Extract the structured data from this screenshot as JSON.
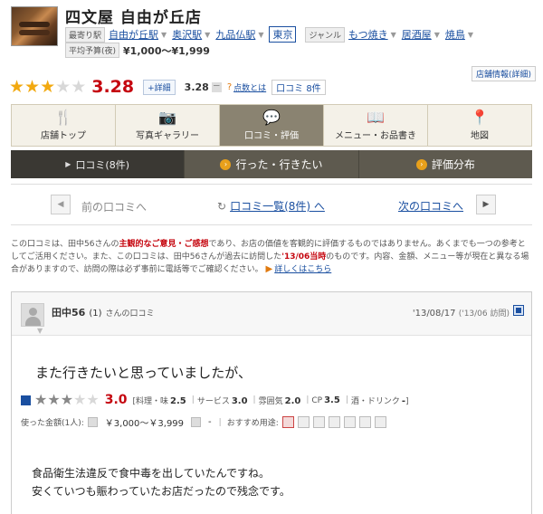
{
  "header": {
    "shop_name": "四文屋 自由が丘店",
    "nearest_label": "最寄り駅",
    "stations": [
      "自由が丘駅",
      "奥沢駅",
      "九品仏駅"
    ],
    "area": "東京",
    "genre_label": "ジャンル",
    "genres": [
      "もつ焼き",
      "居酒屋",
      "焼鳥"
    ],
    "budget_label": "平均予算(夜)",
    "budget": "¥1,000～¥1,999",
    "store_info": "店舗情報(詳細)"
  },
  "rating": {
    "stars": 3,
    "score": "3.28",
    "detail_button": "+詳細",
    "sub_score": "3.28",
    "sub_minus": "－",
    "score_info_link": "点数とは",
    "review_link": "口コミ 8件"
  },
  "tabs": [
    {
      "label": "店舗トップ",
      "icon": "fork-knife-icon",
      "glyph": "🍴"
    },
    {
      "label": "写真ギャラリー",
      "icon": "camera-icon",
      "glyph": "📷"
    },
    {
      "label": "口コミ・評価",
      "icon": "speech-bubble-icon",
      "glyph": "💬"
    },
    {
      "label": "メニュー・お品書き",
      "icon": "book-icon",
      "glyph": "📖"
    },
    {
      "label": "地図",
      "icon": "map-pin-icon",
      "glyph": "📍"
    }
  ],
  "subtabs": [
    {
      "label": "口コミ(8件)"
    },
    {
      "label": "行った・行きたい"
    },
    {
      "label": "評価分布"
    }
  ],
  "pager": {
    "prev": "前の口コミへ",
    "list": "口コミ一覧(8件) へ",
    "next": "次の口コミへ",
    "prev_arrow": "◀",
    "next_arrow": "▶",
    "list_icon": "↻"
  },
  "notice": {
    "p1a": "この口コミは、田中56さんの",
    "p1b": "主観的なご意見・ご感想",
    "p1c": "であり、お店の価値を客観的に評価するものではありません。あくまでも一つの参考としてご活用ください。また、この口コミは、田中56さんが過去に訪問した",
    "p1d": "'13/06当時",
    "p1e": "のものです。内容、金額、メニュー等が現在と異なる場合がありますので、訪問の際は必ず事前に電話等でご確認ください。",
    "more": "詳しくはこちら"
  },
  "review": {
    "user": "田中56",
    "count": "(1)",
    "suffix": "さんの口コミ",
    "date": "'13/08/17",
    "visit": "('13/06 訪問)",
    "title": "また行きたいと思っていましたが、",
    "stars": 3,
    "score": "3.0",
    "sub_scores": [
      {
        "label": "[料理・味",
        "value": "2.5"
      },
      {
        "label": "サービス",
        "value": "3.0"
      },
      {
        "label": "雰囲気",
        "value": "2.0"
      },
      {
        "label": "CP",
        "value": "3.5"
      },
      {
        "label": "酒・ドリンク",
        "value": "-"
      }
    ],
    "close_bracket": "]",
    "spend_label": "使った金額(1人):",
    "spend": "￥3,000～￥3,999",
    "lunch_spend": "-",
    "uses_label": "おすすめ用途:",
    "body_line1": "食品衛生法違反で食中毒を出していたんですね。",
    "body_line2": "安くていつも賑わっていたお店だったので残念です。"
  }
}
